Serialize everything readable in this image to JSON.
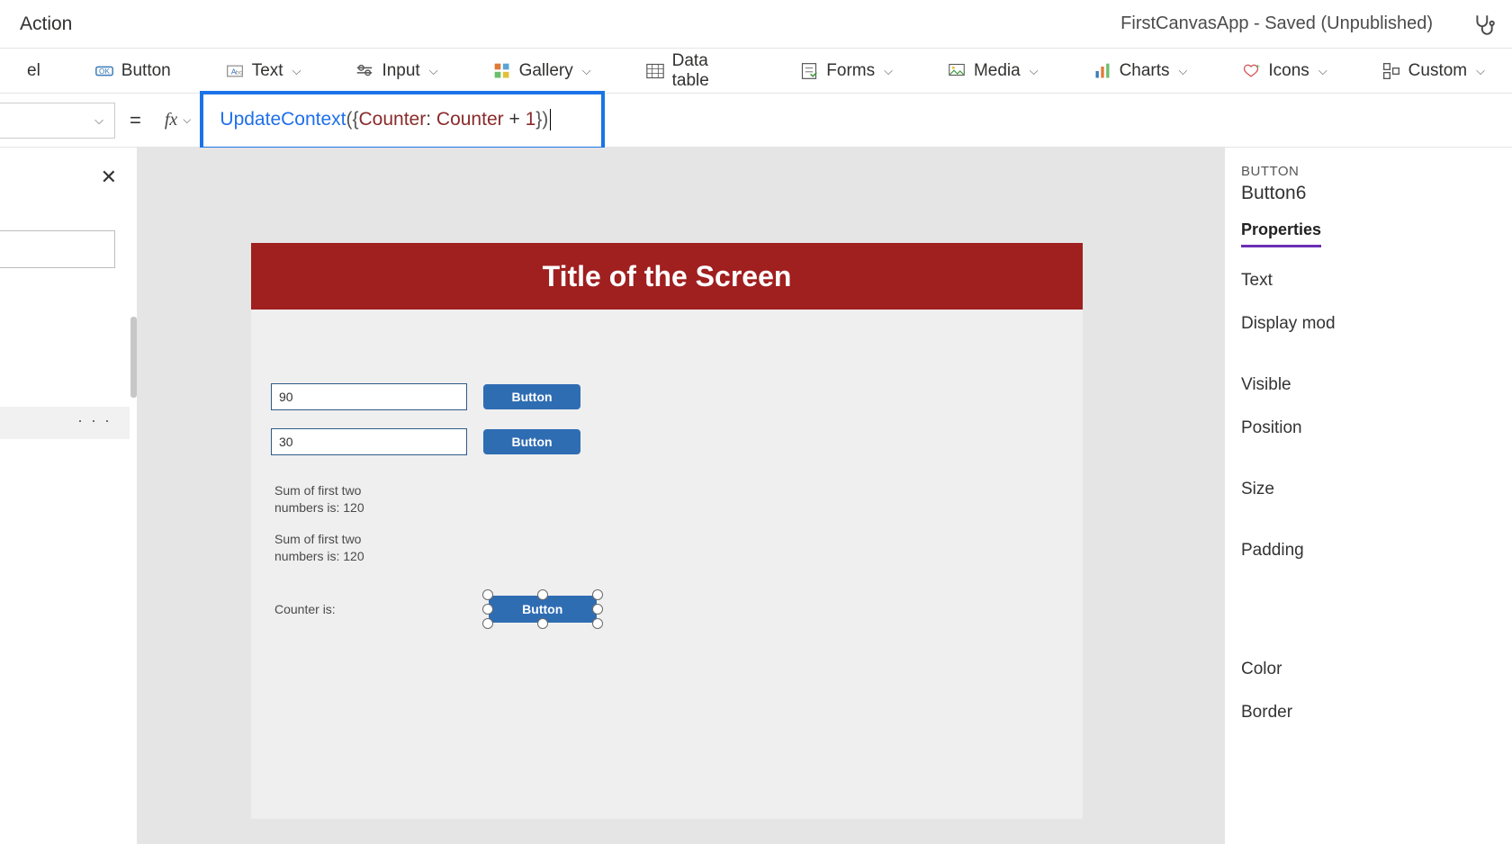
{
  "topbar": {
    "menu": "Action",
    "title": "FirstCanvasApp - Saved (Unpublished)"
  },
  "ribbon": {
    "label_partial": "el",
    "button": "Button",
    "text": "Text",
    "input": "Input",
    "gallery": "Gallery",
    "datatable": "Data table",
    "forms": "Forms",
    "media": "Media",
    "charts": "Charts",
    "icons": "Icons",
    "custom": "Custom"
  },
  "formula": {
    "eq": "=",
    "fx": "fx",
    "fn": "UpdateContext",
    "open1": "(",
    "open2": "{",
    "field": "Counter",
    "colon": ": ",
    "ref": "Counter",
    "op": " + ",
    "num": "1",
    "close2": "}",
    "close1": ")"
  },
  "leftpane": {
    "dots": "· · ·"
  },
  "canvas": {
    "title": "Title of the Screen",
    "input1": "90",
    "input2": "30",
    "btn1": "Button",
    "btn2": "Button",
    "sum_a": "Sum of first two numbers is: 120",
    "sum_b": "Sum of first two numbers is: 120",
    "counter_label": "Counter is:",
    "sel_btn": "Button"
  },
  "props": {
    "type": "BUTTON",
    "name": "Button6",
    "tab": "Properties",
    "items": {
      "text": "Text",
      "display": "Display mod",
      "visible": "Visible",
      "position": "Position",
      "size": "Size",
      "padding": "Padding",
      "color": "Color",
      "border": "Border"
    }
  }
}
